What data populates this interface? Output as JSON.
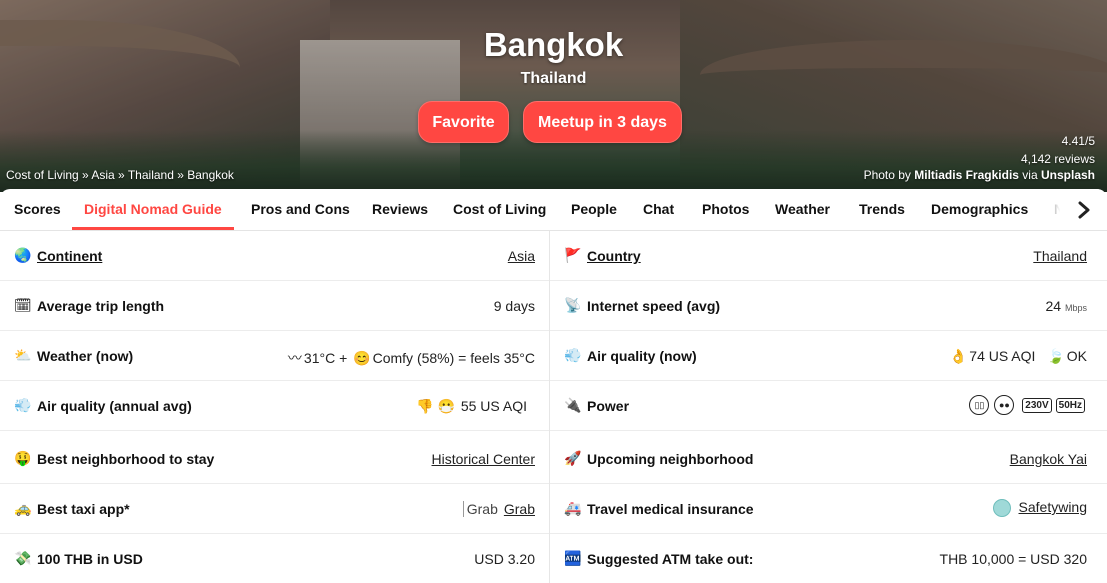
{
  "hero": {
    "city": "Bangkok",
    "country": "Thailand",
    "favorite_label": "Favorite",
    "meetup_label": "Meetup in 3 days",
    "breadcrumb": "Cost of Living » Asia » Thailand » Bangkok",
    "rating": "4.41/5",
    "reviews": "4,142 reviews",
    "photo_prefix": "Photo by ",
    "photographer": "Miltiadis Fragkidis",
    "photo_via": " via ",
    "photo_source": "Unsplash"
  },
  "tabs": [
    {
      "label": "Scores"
    },
    {
      "label": "Digital Nomad Guide",
      "active": true
    },
    {
      "label": "Pros and Cons"
    },
    {
      "label": "Reviews"
    },
    {
      "label": "Cost of Living"
    },
    {
      "label": "People"
    },
    {
      "label": "Chat"
    },
    {
      "label": "Photos"
    },
    {
      "label": "Weather"
    },
    {
      "label": "Trends"
    },
    {
      "label": "Demographics"
    },
    {
      "label": "N"
    }
  ],
  "tab_arrow_icon": "chevron-right-icon",
  "rows": {
    "continent": {
      "label": "Continent",
      "value": "Asia",
      "icon": "🌏"
    },
    "country": {
      "label": "Country",
      "value": "Thailand",
      "icon": "🚩"
    },
    "trip": {
      "label": "Average trip length",
      "value": "9 days",
      "icon": "🗓"
    },
    "internet": {
      "label": "Internet speed (avg)",
      "value": "24",
      "unit": "Mbps",
      "icon": "📡"
    },
    "weather": {
      "label": "Weather (now)",
      "temp": "31°C",
      "plus": "+",
      "comfy": "Comfy (58%) = feels 35°C",
      "icon": "⛅"
    },
    "airnow": {
      "label": "Air quality (now)",
      "aqi": "74 US AQI",
      "status": "OK",
      "icon": "💨"
    },
    "airavg": {
      "label": "Air quality (annual avg)",
      "aqi": "55 US AQI",
      "icon": "💨"
    },
    "power": {
      "label": "Power",
      "voltage": "230V",
      "freq": "50Hz",
      "icon": "🔌"
    },
    "neighborhood": {
      "label": "Best neighborhood to stay",
      "value": "Historical Center",
      "icon": "🤑"
    },
    "upcoming": {
      "label": "Upcoming neighborhood",
      "value": "Bangkok Yai",
      "icon": "🚀"
    },
    "taxi": {
      "label": "Best taxi app*",
      "img_alt": "Grab",
      "value": "Grab",
      "icon": "🚕"
    },
    "insurance": {
      "label": "Travel medical insurance",
      "value": "Safetywing",
      "icon": "🚑"
    },
    "usd": {
      "label": "100 THB in USD",
      "value": "USD 3.20",
      "icon": "💸"
    },
    "atm": {
      "label": "Suggested ATM take out:",
      "value": "THB 10,000 = USD 320",
      "icon": "🏧"
    }
  }
}
